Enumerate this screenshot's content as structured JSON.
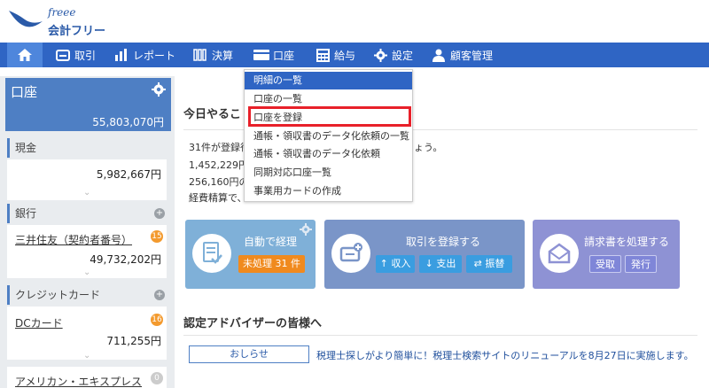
{
  "logo": {
    "script": "freee",
    "name": "会計フリー"
  },
  "nav": {
    "home_icon": "home-icon",
    "items": [
      {
        "label": "取引",
        "icon": "inbox-icon"
      },
      {
        "label": "レポート",
        "icon": "bar-chart-icon"
      },
      {
        "label": "決算",
        "icon": "books-icon"
      },
      {
        "label": "口座",
        "icon": "card-icon"
      },
      {
        "label": "給与",
        "icon": "calculator-icon"
      },
      {
        "label": "設定",
        "icon": "gear-icon"
      },
      {
        "label": "顧客管理",
        "icon": "person-icon"
      }
    ]
  },
  "dropdown": {
    "items": [
      "明細の一覧",
      "口座の一覧",
      "口座を登録",
      "通帳・領収書のデータ化依頼の一覧",
      "通帳・領収書のデータ化依頼",
      "同期対応口座一覧",
      "事業用カードの作成"
    ],
    "active_index": 0,
    "highlighted_index": 2
  },
  "sidebar": {
    "title": "口座",
    "total": "55,803,070円",
    "cash": {
      "label": "現金",
      "amount": "5,982,667円"
    },
    "bank": {
      "label": "銀行",
      "account": "三井住友（契約者番号）",
      "badge": "15",
      "amount": "49,732,202円"
    },
    "credit": {
      "label": "クレジットカード",
      "account": "DCカード",
      "badge": "16",
      "amount": "711,255円"
    },
    "amex": {
      "account": "アメリカン・エキスプレス",
      "badge": "0"
    }
  },
  "main": {
    "today_title": "今日やるこ",
    "todos": [
      "31件が登録待",
      "1,452,229円の",
      "256,160円の",
      "経費精算で、"
    ],
    "todo_tail": "ょう。",
    "cards": {
      "auto": {
        "title": "自動で経理",
        "button": "未処理 31 件"
      },
      "transaction": {
        "title": "取引を登録する",
        "income": "↑ 収入",
        "expense": "↓ 支出",
        "transfer": "⇄ 振替"
      },
      "invoice": {
        "title": "請求書を処理する",
        "receive": "受取",
        "issue": "発行"
      }
    },
    "advisor_title": "認定アドバイザーの皆様へ",
    "notice_button": "おしらせ",
    "notice_text": "税理士探しがより簡単に！税理士検索サイトのリニューアルを8月27日に実施します。"
  },
  "colors": {
    "nav": "#2f65c4",
    "highlight": "#e8202a",
    "badge": "#f39a2e"
  }
}
